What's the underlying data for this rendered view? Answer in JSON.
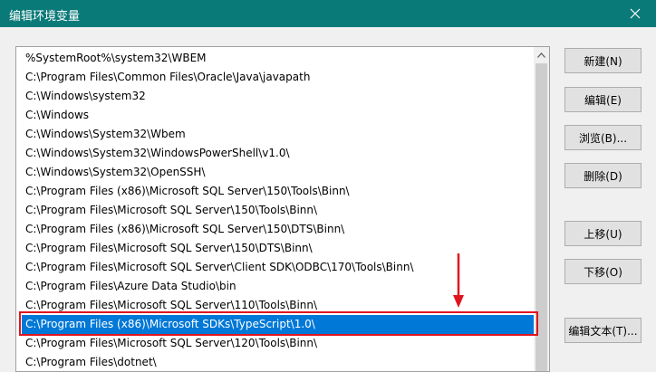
{
  "window": {
    "title": "编辑环境变量"
  },
  "list": {
    "items": [
      "%SystemRoot%\\system32\\WBEM",
      "C:\\Program Files\\Common Files\\Oracle\\Java\\javapath",
      "C:\\Windows\\system32",
      "C:\\Windows",
      "C:\\Windows\\System32\\Wbem",
      "C:\\Windows\\System32\\WindowsPowerShell\\v1.0\\",
      "C:\\Windows\\System32\\OpenSSH\\",
      "C:\\Program Files (x86)\\Microsoft SQL Server\\150\\Tools\\Binn\\",
      "C:\\Program Files\\Microsoft SQL Server\\150\\Tools\\Binn\\",
      "C:\\Program Files (x86)\\Microsoft SQL Server\\150\\DTS\\Binn\\",
      "C:\\Program Files\\Microsoft SQL Server\\150\\DTS\\Binn\\",
      "C:\\Program Files\\Microsoft SQL Server\\Client SDK\\ODBC\\170\\Tools\\Binn\\",
      "C:\\Program Files\\Azure Data Studio\\bin",
      "C:\\Program Files\\Microsoft SQL Server\\110\\Tools\\Binn\\",
      "C:\\Program Files (x86)\\Microsoft SDKs\\TypeScript\\1.0\\",
      "C:\\Program Files\\Microsoft SQL Server\\120\\Tools\\Binn\\",
      "C:\\Program Files\\dotnet\\"
    ],
    "selected_index": 14
  },
  "buttons": {
    "new": "新建(N)",
    "edit": "编辑(E)",
    "browse": "浏览(B)...",
    "delete": "删除(D)",
    "move_up": "上移(U)",
    "move_down": "下移(O)",
    "edit_text": "编辑文本(T)..."
  },
  "colors": {
    "titlebar": "#0a7a79",
    "selection": "#0078d7",
    "annotation": "#e0141e"
  }
}
